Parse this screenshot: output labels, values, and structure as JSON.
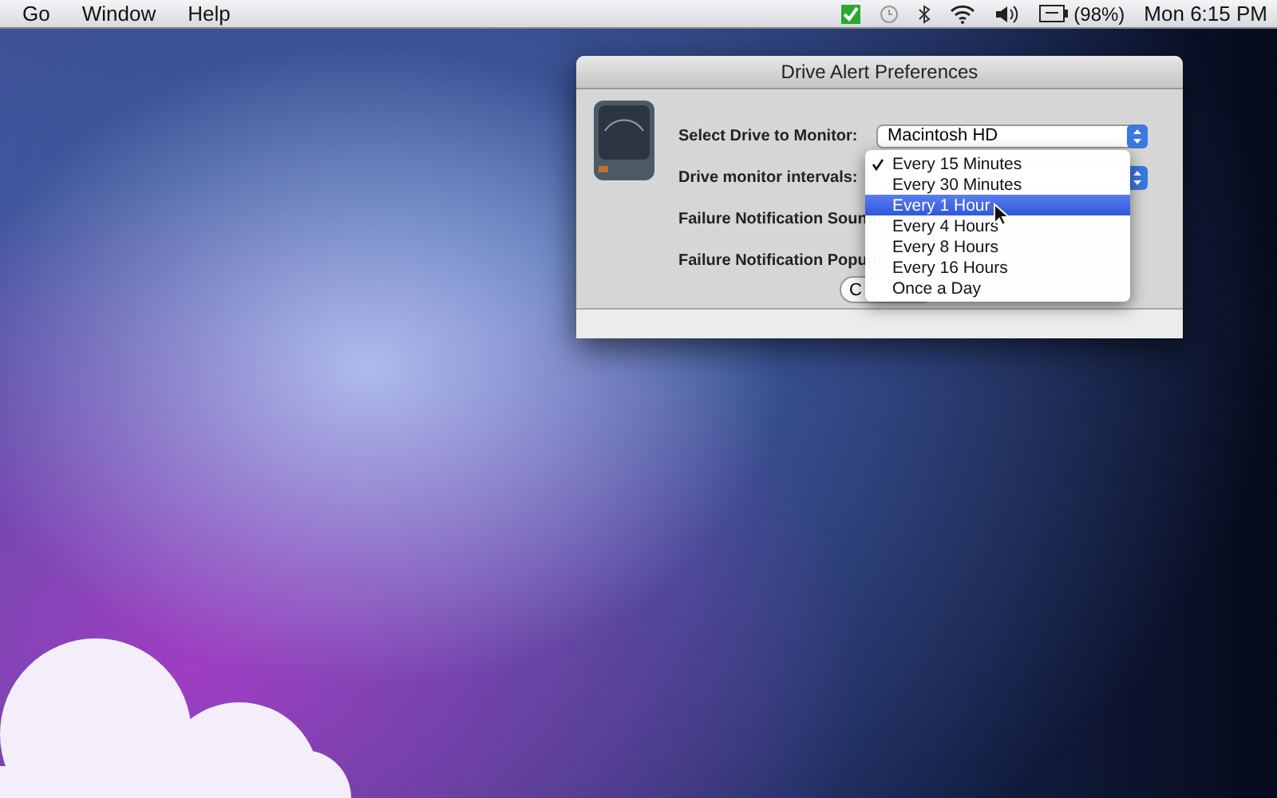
{
  "menu_bar": {
    "menus": [
      "Go",
      "Window",
      "Help"
    ],
    "battery": "(98%)",
    "clock": "Mon 6:15 PM"
  },
  "window": {
    "title": "Drive Alert Preferences",
    "fields": [
      {
        "label": "Select Drive to Monitor:",
        "value": "Macintosh HD"
      },
      {
        "label": "Drive monitor intervals:"
      },
      {
        "label": "Failure Notification Sound:"
      },
      {
        "label": "Failure Notification Popup:"
      }
    ],
    "button": "C",
    "popup_menu": [
      {
        "label": "Every 15 Minutes",
        "checked": true,
        "highlighted": false
      },
      {
        "label": "Every 30 Minutes",
        "checked": false,
        "highlighted": false
      },
      {
        "label": "Every 1 Hour",
        "checked": false,
        "highlighted": true
      },
      {
        "label": "Every 4 Hours",
        "checked": false,
        "highlighted": false
      },
      {
        "label": "Every 8 Hours",
        "checked": false,
        "highlighted": false
      },
      {
        "label": "Every 16 Hours",
        "checked": false,
        "highlighted": false
      },
      {
        "label": "Once a Day",
        "checked": false,
        "highlighted": false
      }
    ]
  }
}
